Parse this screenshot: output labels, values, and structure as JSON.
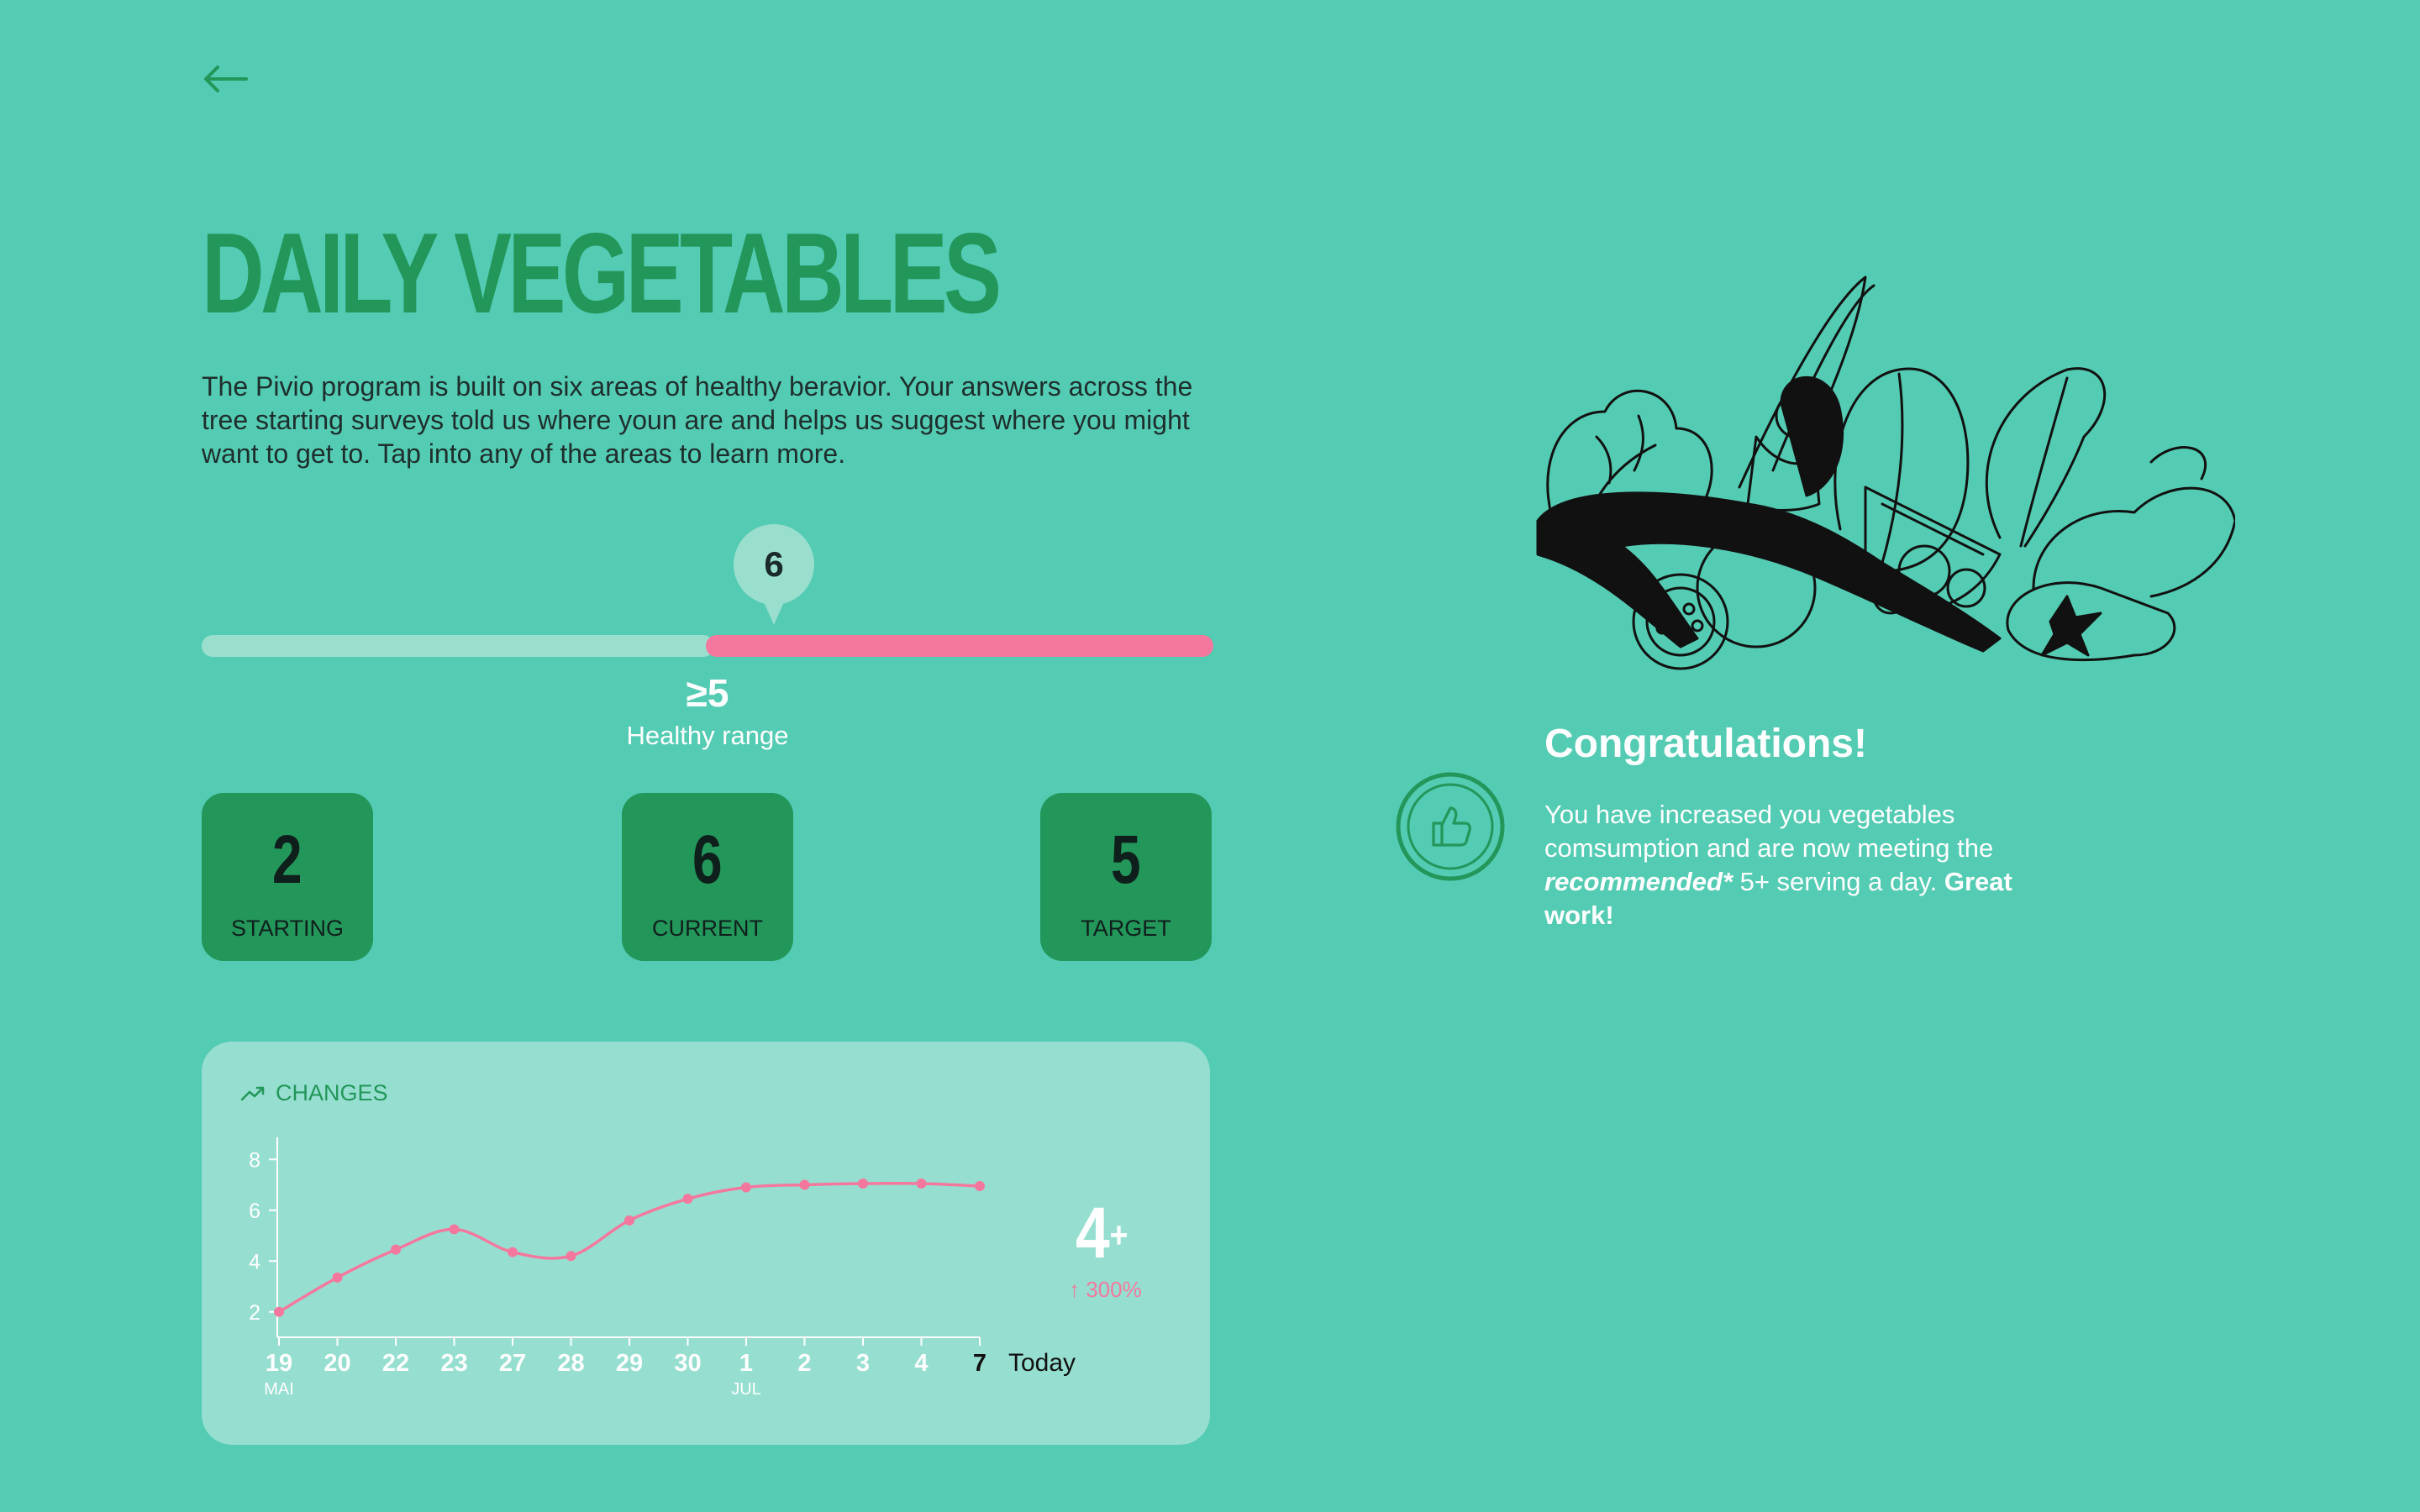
{
  "header": {
    "back_icon": "arrow-left-icon",
    "title": "DAILY VEGETABLES",
    "intro": "The Pivio program is  built on six areas of healthy beravior. Your answers across the tree starting surveys told us where youn are and helps us suggest where you might want to get to. Tap into any of the areas to learn more."
  },
  "range": {
    "current_bubble": "6",
    "healthy_value": "≥5",
    "healthy_label": "Healthy range",
    "track_color": "#9adfce",
    "fill_color": "#f4789e"
  },
  "stats": [
    {
      "value": "2",
      "label": "STARTING"
    },
    {
      "value": "6",
      "label": "CURRENT"
    },
    {
      "value": "5",
      "label": "TARGET"
    }
  ],
  "changes": {
    "label": "CHANGES",
    "icon": "trending-up-icon",
    "big_value": "4",
    "big_value_suffix": "+",
    "delta": "↑ 300%"
  },
  "chart_data": {
    "type": "line",
    "x": [
      "19",
      "20",
      "22",
      "23",
      "27",
      "28",
      "29",
      "30",
      "1",
      "2",
      "3",
      "4",
      "7"
    ],
    "x_sublabels": {
      "19": "MAI",
      "1": "JUL"
    },
    "x_end_label": "Today",
    "y": [
      2.0,
      3.35,
      4.45,
      5.25,
      4.35,
      4.2,
      5.6,
      6.45,
      6.9,
      7.0,
      7.05,
      7.05,
      6.95
    ],
    "yticks": [
      2,
      4,
      6,
      8
    ],
    "ylim": [
      1,
      9
    ],
    "line_color": "#f4789e",
    "grid": false
  },
  "congrats": {
    "badge_icon": "thumbs-up-icon",
    "title": "Congratulations!",
    "body_part1": "You have increased you vegetables comsumption and are now meeting the ",
    "body_em": "recommended*",
    "body_part2": " 5+ serving a day. ",
    "body_strong": "Great work!",
    "illustration": "woman-stretching-with-vegetables-illustration"
  },
  "colors": {
    "background": "#54cbb3",
    "accent_green": "#23965a",
    "pink": "#f4789e",
    "card": "#96dfd0"
  }
}
